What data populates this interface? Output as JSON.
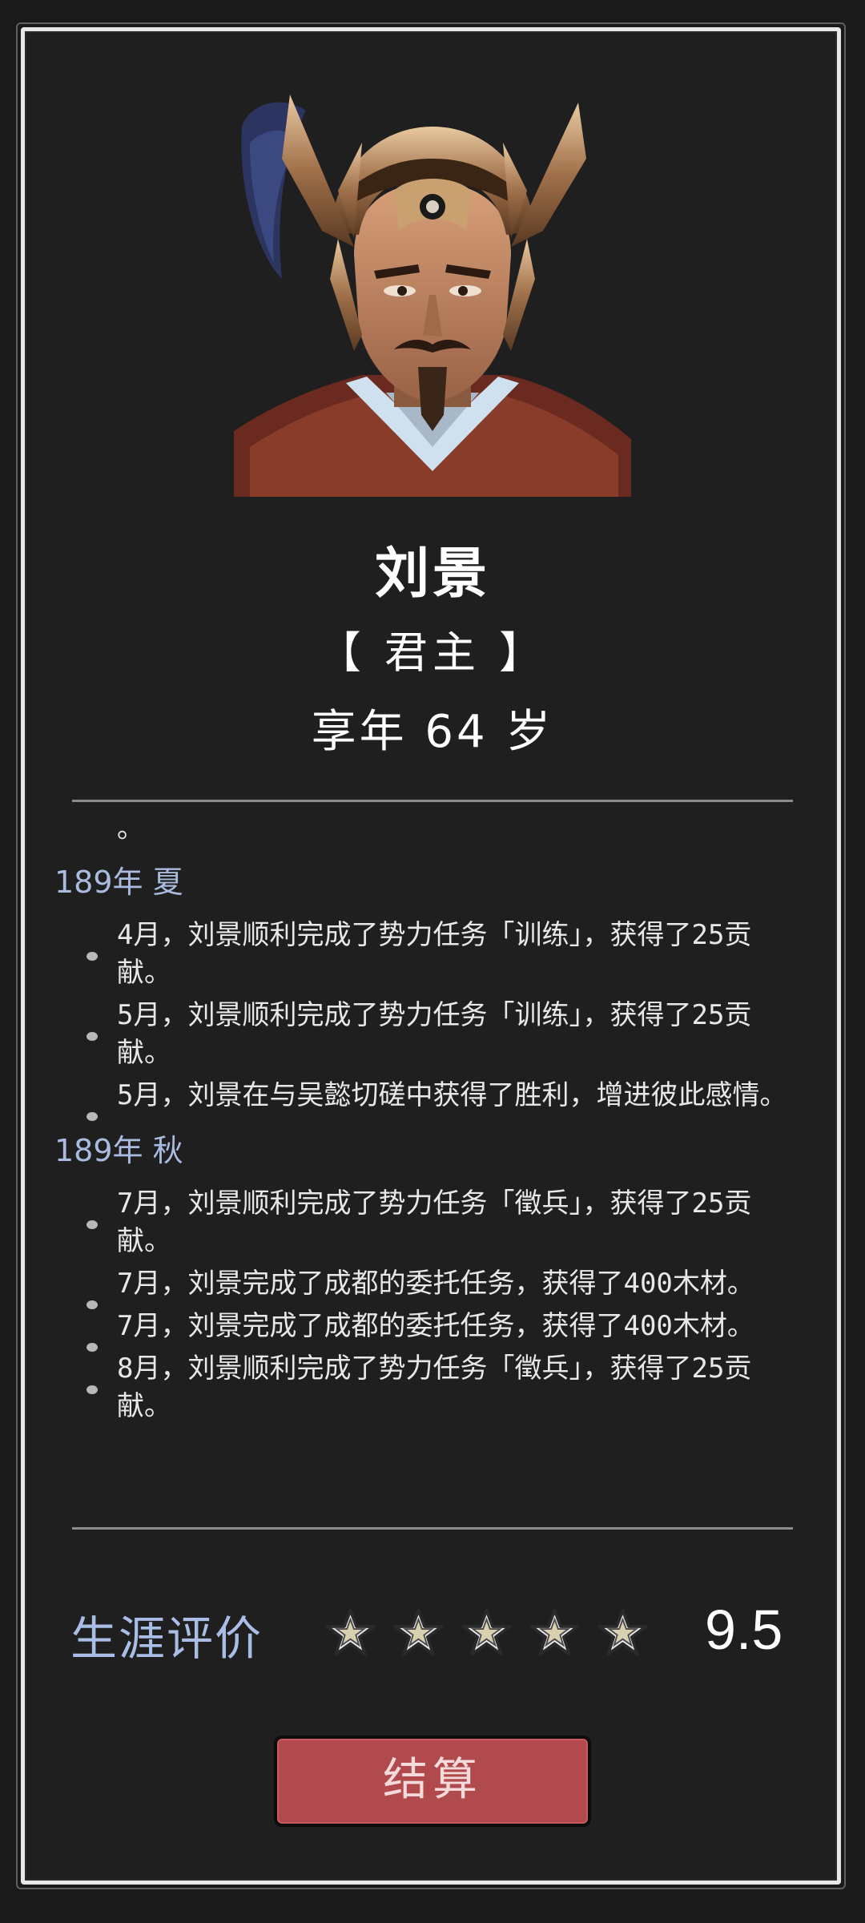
{
  "character": {
    "name": "刘景",
    "role": "【 君主 】",
    "age_text": "享年 64 岁"
  },
  "log": {
    "leading_fragment": "。",
    "sections": [
      {
        "season": "189年 夏",
        "entries": [
          "4月，刘景顺利完成了势力任务「训练」，获得了25贡献。",
          "5月，刘景顺利完成了势力任务「训练」，获得了25贡献。",
          "5月，刘景在与吴懿切磋中获得了胜利，增进彼此感情。"
        ]
      },
      {
        "season": "189年 秋",
        "entries": [
          "7月，刘景顺利完成了势力任务「徵兵」，获得了25贡献。",
          "7月，刘景完成了成都的委托任务，获得了400木材。",
          "7月，刘景完成了成都的委托任务，获得了400木材。",
          "8月，刘景顺利完成了势力任务「徵兵」，获得了25贡献。"
        ]
      }
    ]
  },
  "rating": {
    "label": "生涯评价",
    "stars": 5,
    "score": "9.5"
  },
  "settle_button": {
    "label": "结算"
  },
  "colors": {
    "background": "#1f1f1f",
    "season_text": "#aabbe0",
    "rating_label": "#a9bde6",
    "button": "#b14a4c"
  },
  "icons": {
    "star": "star-icon",
    "bullet": "bullet-icon"
  }
}
